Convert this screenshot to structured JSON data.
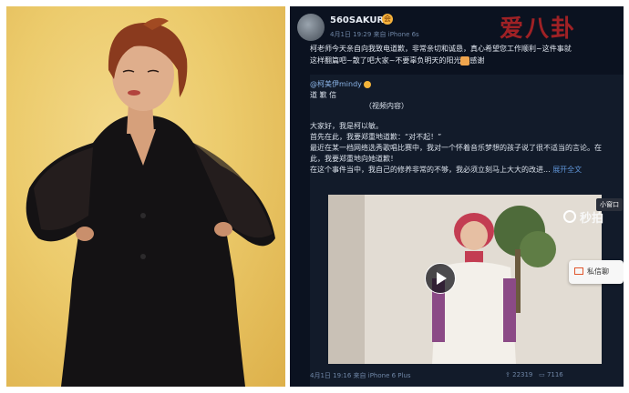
{
  "watermark": "爱八卦",
  "post": {
    "username": "560SAKURA",
    "vip_badge": "会",
    "meta": "4月1日 19:29 来自 iPhone 6s",
    "lines": [
      "柯老师今天亲自向我致电道歉，非常亲切和诚恳，真心希望您工作顺利~这件事就",
      "这样翻篇吧~散了吧大家~不要辜负明天的阳光"
    ],
    "thanks": "感谢"
  },
  "repost": {
    "mention": "@柯美伊mindy",
    "title": "道 歉 信",
    "video_note": "（视频内容）",
    "paragraphs": [
      "大家好，我是柯以敏。",
      "首先在此，我要郑重地道歉：“对不起！”",
      "最近在某一档网络选秀歌唱比赛中，我对一个怀着音乐梦想的孩子说了很不适当的言论。在",
      "此，我要郑重地向她道歉！",
      "在这个事件当中，我自己的修养非常的不够，我必须立刻马上大大的改进..."
    ],
    "full_text": "展开全文",
    "meta": "4月1日 19:16 来自 iPhone 6 Plus",
    "stats": [
      "22319",
      "7116"
    ]
  },
  "video": {
    "small_window": "小窗口",
    "brand": "秒拍",
    "private_message": "私信聊"
  },
  "colors": {
    "panel_bg": "#0b1220",
    "link": "#5f95d8",
    "photo_bg": "#eccb6c",
    "watermark": "#de2828"
  }
}
